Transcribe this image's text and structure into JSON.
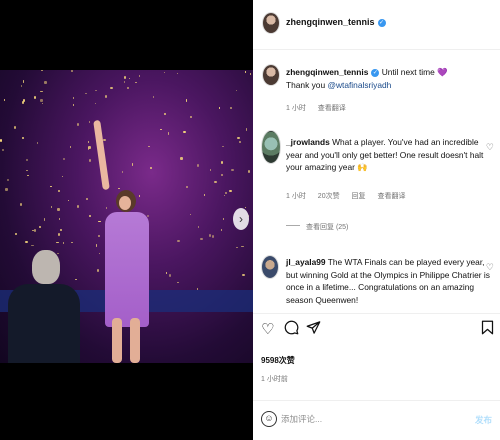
{
  "header": {
    "username": "zhengqinwen_tennis",
    "verified_icon": "verified-badge-icon"
  },
  "caption": {
    "username": "zhengqinwen_tennis",
    "text_line1": "Until next time 💜",
    "text_line2_prefix": "Thank you ",
    "mention": "@wtafinalsriyadh",
    "time": "1 小时",
    "translate": "查看翻译"
  },
  "comments": [
    {
      "username": "_jrowlands",
      "text": "What a player. You've had an incredible year and you'll only get better! One result doesn't halt your amazing year 🙌",
      "time": "1 小时",
      "likes": "20次赞",
      "reply": "回复",
      "translate": "查看翻译",
      "view_replies": "查看回复 (25)"
    },
    {
      "username": "jl_ayala99",
      "text": "The WTA Finals can be played every year, but winning Gold at the Olympics in Philippe Chatrier is once in a lifetime... Congratulations on an amazing season Queenwen!"
    }
  ],
  "likes_count": "9598次赞",
  "post_time": "1 小时前",
  "comment_box": {
    "placeholder": "添加评论...",
    "post_label": "发布"
  },
  "icons": {
    "like": "heart-icon",
    "comment": "comment-icon",
    "share": "share-icon",
    "save": "bookmark-icon",
    "emoji": "emoji-icon",
    "next": "chevron-right-icon"
  },
  "colors": {
    "verified": "#3897f0",
    "link": "#1a4a8a",
    "post_button": "#b2dffc"
  }
}
